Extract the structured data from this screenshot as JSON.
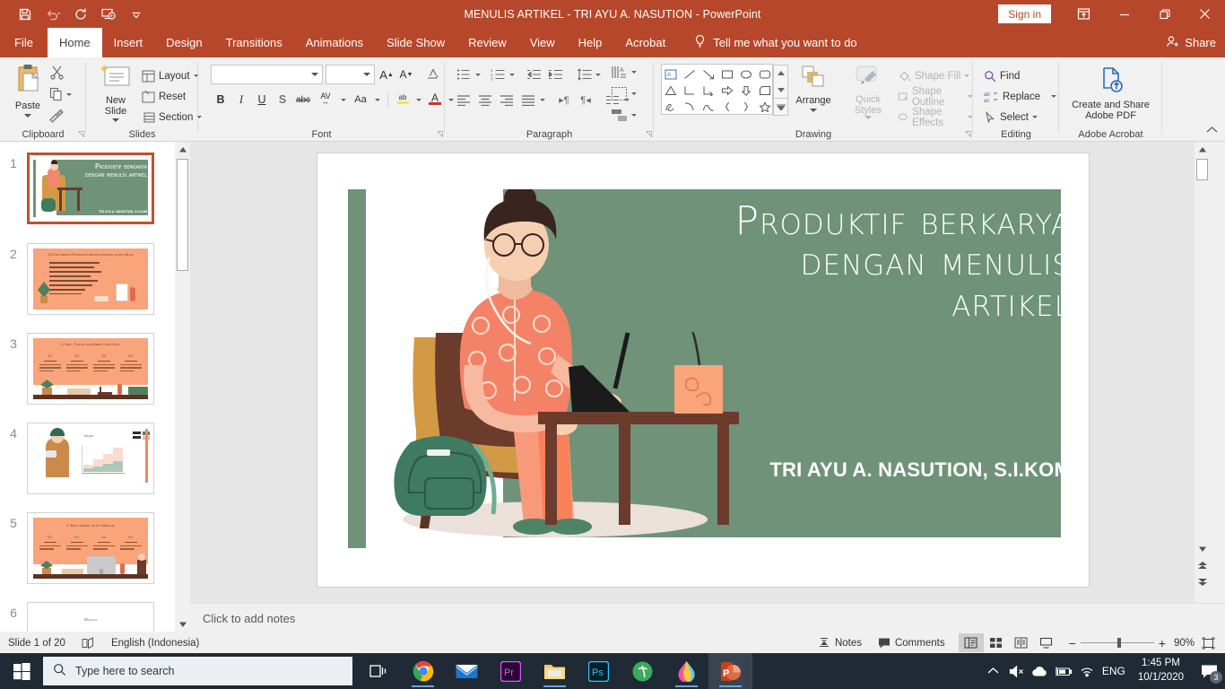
{
  "titlebar": {
    "document_title": "MENULIS ARTIKEL - TRI AYU A. NASUTION  -  PowerPoint",
    "signin_label": "Sign in",
    "qat": [
      {
        "name": "save-icon",
        "tooltip": "Save"
      },
      {
        "name": "undo-icon",
        "tooltip": "Undo"
      },
      {
        "name": "redo-icon",
        "tooltip": "Redo"
      },
      {
        "name": "start-from-beginning-icon",
        "tooltip": "Start From Beginning"
      },
      {
        "name": "customize-quick-access-toolbar-icon",
        "tooltip": "Customize Quick Access Toolbar"
      }
    ],
    "window_buttons": [
      "ribbon-display-options",
      "minimize",
      "restore",
      "close"
    ]
  },
  "tabs": [
    {
      "label": "File",
      "active": false
    },
    {
      "label": "Home",
      "active": true
    },
    {
      "label": "Insert",
      "active": false
    },
    {
      "label": "Design",
      "active": false
    },
    {
      "label": "Transitions",
      "active": false
    },
    {
      "label": "Animations",
      "active": false
    },
    {
      "label": "Slide Show",
      "active": false
    },
    {
      "label": "Review",
      "active": false
    },
    {
      "label": "View",
      "active": false
    },
    {
      "label": "Help",
      "active": false
    },
    {
      "label": "Acrobat",
      "active": false
    }
  ],
  "tellme": {
    "label": "Tell me what you want to do"
  },
  "share": {
    "label": "Share"
  },
  "ribbon": {
    "clipboard": {
      "group_label": "Clipboard",
      "paste_label": "Paste",
      "items": [
        "Cut",
        "Copy",
        "Format Painter"
      ]
    },
    "slides": {
      "group_label": "Slides",
      "new_slide_label": "New Slide",
      "layout_label": "Layout",
      "reset_label": "Reset",
      "section_label": "Section"
    },
    "font": {
      "group_label": "Font",
      "font_name_value": "",
      "font_size_value": "",
      "buttons": [
        "Bold",
        "Italic",
        "Underline",
        "Text Shadow",
        "Strikethrough",
        "Character Spacing",
        "Change Case",
        "Text Highlight Color",
        "Font Color",
        "Increase Font Size",
        "Decrease Font Size",
        "Clear All Formatting"
      ],
      "bold": "B",
      "italic": "I",
      "underline": "U",
      "shadow": "S",
      "strike": "abc",
      "spacing": "AV",
      "case": "Aa",
      "font_color": "A"
    },
    "paragraph": {
      "group_label": "Paragraph"
    },
    "drawing": {
      "group_label": "Drawing",
      "arrange_label": "Arrange",
      "quick_styles_label": "Quick Styles",
      "shape_fill_label": "Shape Fill",
      "shape_outline_label": "Shape Outline",
      "shape_effects_label": "Shape Effects"
    },
    "editing": {
      "group_label": "Editing",
      "find_label": "Find",
      "replace_label": "Replace",
      "select_label": "Select"
    },
    "acrobat": {
      "group_label": "Adobe Acrobat",
      "button_line1": "Create and Share",
      "button_line2": "Adobe PDF"
    },
    "collapse_ribbon": "collapse-ribbon"
  },
  "thumbnails": [
    {
      "number": "1",
      "selected": true,
      "kind": "title"
    },
    {
      "number": "2",
      "selected": false,
      "kind": "bullets",
      "heading": "10 Kiat Ampuh Produktif Menulis Artikel untuk Blog"
    },
    {
      "number": "3",
      "selected": false,
      "kind": "steps4",
      "heading": "1. Niat, Tujuan, dan Ambisi yang Kuat"
    },
    {
      "number": "4",
      "selected": false,
      "kind": "chart",
      "heading": "Target"
    },
    {
      "number": "5",
      "selected": false,
      "kind": "steps4",
      "heading": "2. Buat Jadwal untuk Menulis"
    },
    {
      "number": "6",
      "selected": false,
      "kind": "plain",
      "heading": "Menulis"
    }
  ],
  "slide": {
    "title_lines": [
      "Produktif berkarya",
      "dengan menulis",
      "artikel"
    ],
    "title_full": "Produktif berkarya dengan menulis artikel",
    "subtitle": "TRI AYU A. NASUTION, S.I.KOM",
    "colors": {
      "green": "#6f9279",
      "orange": "#f2886a",
      "orange_light": "#fba98a",
      "skin": "#f3cfb5",
      "chair": "#d29a45",
      "wood": "#6b3b2c",
      "hair": "#3a2420",
      "backpack": "#3f7a62",
      "white": "#ffffff"
    }
  },
  "notes": {
    "placeholder": "Click to add notes"
  },
  "statusbar": {
    "slide_indicator": "Slide 1 of 20",
    "spellcheck_icon": "spell-check-icon",
    "language": "English (Indonesia)",
    "notes_label": "Notes",
    "comments_label": "Comments",
    "views": [
      {
        "name": "normal-view",
        "active": true
      },
      {
        "name": "slide-sorter-view",
        "active": false
      },
      {
        "name": "reading-view",
        "active": false
      },
      {
        "name": "slide-show-view",
        "active": false
      }
    ],
    "zoom_out": "−",
    "zoom_in": "+",
    "zoom_level": "90%",
    "fit_slide": "fit-slide-to-window-icon"
  },
  "taskbar": {
    "start": "windows-start-icon",
    "search_placeholder": "Type here to search",
    "apps": [
      {
        "name": "task-view-icon",
        "label": "Task View",
        "open": false,
        "active": false
      },
      {
        "name": "google-chrome-icon",
        "label": "Google Chrome",
        "open": true,
        "active": false
      },
      {
        "name": "mail-icon",
        "label": "Mail",
        "open": false,
        "active": false
      },
      {
        "name": "adobe-premiere-pro-icon",
        "label": "Adobe Premiere Pro",
        "open": false,
        "active": false
      },
      {
        "name": "file-explorer-icon",
        "label": "File Explorer",
        "open": true,
        "active": false
      },
      {
        "name": "adobe-photoshop-icon",
        "label": "Adobe Photoshop",
        "open": false,
        "active": false
      },
      {
        "name": "spotify-icon",
        "label": "Spotify",
        "open": false,
        "active": false
      },
      {
        "name": "paint-3d-icon",
        "label": "Paint 3D",
        "open": true,
        "active": false
      },
      {
        "name": "powerpoint-icon",
        "label": "Microsoft PowerPoint",
        "open": true,
        "active": true
      }
    ],
    "tray": [
      {
        "name": "show-hidden-icons-chevron"
      },
      {
        "name": "volume-muted-icon"
      },
      {
        "name": "onedrive-cloud-icon"
      },
      {
        "name": "battery-charging-icon"
      },
      {
        "name": "wifi-icon"
      }
    ],
    "language_indicator": "ENG",
    "time": "1:45 PM",
    "date": "10/1/2020",
    "notification_count": "3"
  }
}
